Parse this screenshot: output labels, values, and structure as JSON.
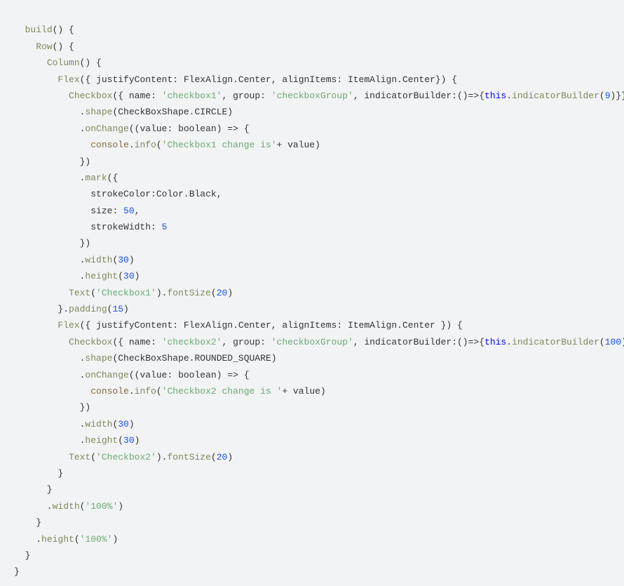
{
  "code": {
    "fn_build": "build",
    "fn_row": "Row",
    "fn_column": "Column",
    "fn_flex": "Flex",
    "fn_checkbox": "Checkbox",
    "fn_shape": "shape",
    "fn_onchange": "onChange",
    "fn_info": "info",
    "fn_mark": "mark",
    "fn_width": "width",
    "fn_height": "height",
    "fn_text": "Text",
    "fn_fontsize": "fontSize",
    "fn_padding": "padding",
    "fn_indicatorbuilder_call": "indicatorBuilder",
    "obj_console": "console",
    "key_justifyContent": "justifyContent",
    "key_alignItems": "alignItems",
    "key_name": "name",
    "key_group": "group",
    "key_indicatorBuilder": "indicatorBuilder",
    "key_strokeColor": "strokeColor",
    "key_size": "size",
    "key_strokeWidth": "strokeWidth",
    "key_value": "value",
    "type_FlexAlign": "FlexAlign",
    "type_ItemAlign": "ItemAlign",
    "type_CheckBoxShape": "CheckBoxShape",
    "type_Color": "Color",
    "type_boolean": "boolean",
    "enum_Center": "Center",
    "enum_CIRCLE": "CIRCLE",
    "enum_ROUNDED_SQUARE": "ROUNDED_SQUARE",
    "enum_Black": "Black",
    "kw_this": "this",
    "str_checkbox1": "'checkbox1'",
    "str_checkbox2": "'checkbox2'",
    "str_checkboxGroup": "'checkboxGroup'",
    "str_cb1change": "'Checkbox1 change is'",
    "str_cb2change": "'Checkbox2 change is '",
    "str_Checkbox1": "'Checkbox1'",
    "str_Checkbox2": "'Checkbox2'",
    "str_100pct": "'100%'",
    "num_9": "9",
    "num_100": "100",
    "num_50": "50",
    "num_5": "5",
    "num_30": "30",
    "num_20": "20",
    "num_15": "15",
    "plus_value": "+ value"
  }
}
